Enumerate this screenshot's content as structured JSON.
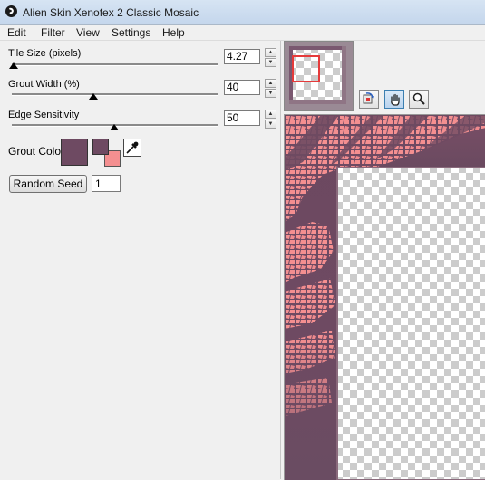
{
  "window": {
    "title": "Alien Skin Xenofex 2 Classic Mosaic"
  },
  "menu": {
    "edit": "Edit",
    "filter": "Filter",
    "view": "View",
    "settings": "Settings",
    "help": "Help"
  },
  "params": {
    "tile_size": {
      "label": "Tile Size (pixels)",
      "value": "4.27"
    },
    "grout_width": {
      "label": "Grout Width (%)",
      "value": "40"
    },
    "edge_sensitivity": {
      "label": "Edge Sensitivity",
      "value": "50"
    }
  },
  "grout_color": {
    "label": "Grout Color",
    "color": "#6e4a62",
    "secondary_color": "#f48f90"
  },
  "random_seed": {
    "button_label": "Random Seed",
    "value": "1"
  },
  "tools": [
    "compare-tool-icon",
    "hand-icon",
    "zoom-icon"
  ],
  "colors": {
    "grout": "#6e4a62",
    "tile": "#f48f90",
    "nav_rect": "#e53b3b"
  }
}
